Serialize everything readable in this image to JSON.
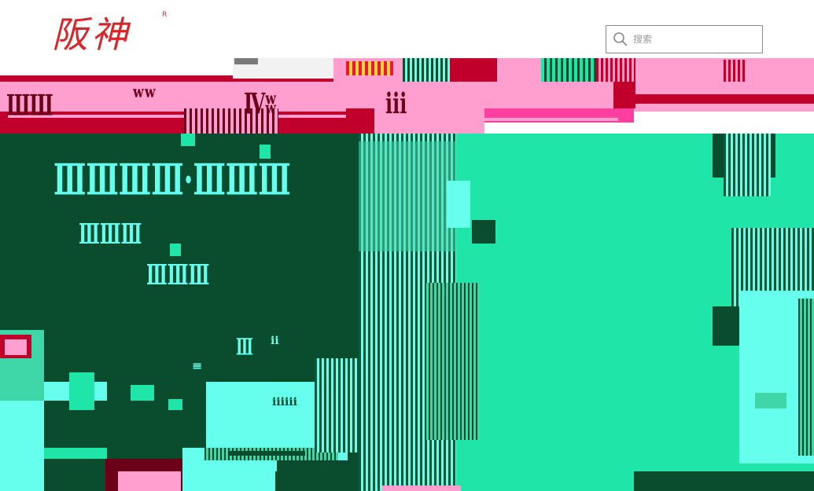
{
  "header": {
    "logo_text": "阪神",
    "logo_mark": "R",
    "search": {
      "placeholder": "搜索",
      "icon": "magnifier-icon"
    }
  },
  "nav": {
    "items": [
      {
        "label": "ШШ"
      },
      {
        "label": "ʷʷ"
      },
      {
        "label": "Ⅳʬ"
      },
      {
        "label": "ⅲ"
      }
    ]
  },
  "banner": {
    "headline": "ⅢⅢⅢⅢ·ⅢⅢⅢ",
    "subline_1": "ⅢⅢⅢ",
    "subline_2": "ⅢⅢⅢ",
    "small_marks": [
      "Ⅲ",
      "ⅱ",
      "≡",
      "ⅲⅲ"
    ]
  },
  "colors": {
    "brand_red": "#d8262b",
    "nav_pink": "#ff9fcf",
    "nav_crimson": "#c0002b",
    "banner_dark": "#0a4d2e",
    "banner_teal": "#1fe6a8",
    "banner_cyan": "#66ffee"
  }
}
